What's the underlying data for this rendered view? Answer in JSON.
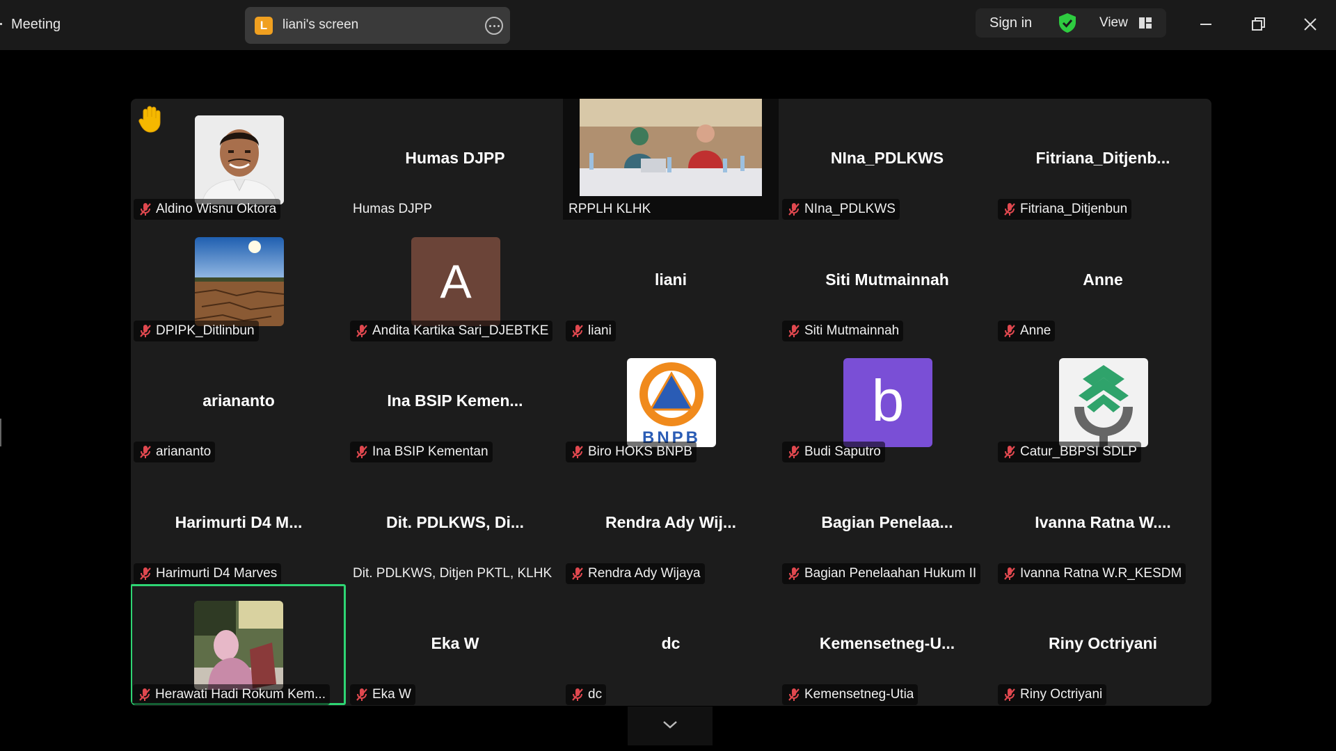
{
  "window": {
    "title": "Meeting",
    "share_badge": "L",
    "share_label": "liani's screen",
    "sign_in": "Sign in",
    "view": "View"
  },
  "colors": {
    "active_speaker": "#2ed573",
    "muted_mic": "#e0484f",
    "raise_hand": "#f5b800",
    "shield": "#2ecc40"
  },
  "gallery": {
    "rows": [
      [
        {
          "name": "Aldino Wisnu Oktora",
          "display": "",
          "kind": "photo-man",
          "muted": true
        },
        {
          "name": "Humas DJPP",
          "display": "Humas DJPP",
          "kind": "name",
          "muted": false
        },
        {
          "name": "RPPLH KLHK",
          "display": "",
          "kind": "video",
          "muted": false
        },
        {
          "name": "NIna_PDLKWS",
          "display": "NIna_PDLKWS",
          "kind": "name",
          "muted": true
        },
        {
          "name": "Fitriana_Ditjenbun",
          "display": "Fitriana_Ditjenb...",
          "kind": "name",
          "muted": true
        }
      ],
      [
        {
          "name": "DPIPK_Ditlinbun",
          "display": "",
          "kind": "photo-land",
          "muted": true
        },
        {
          "name": "Andita Kartika Sari_DJEBTKE",
          "display": "",
          "kind": "letter-a",
          "muted": true
        },
        {
          "name": "liani",
          "display": "liani",
          "kind": "name",
          "muted": true
        },
        {
          "name": "Siti Mutmainnah",
          "display": "Siti Mutmainnah",
          "kind": "name",
          "muted": true
        },
        {
          "name": "Anne",
          "display": "Anne",
          "kind": "name",
          "muted": true
        }
      ],
      [
        {
          "name": "ariananto",
          "display": "ariananto",
          "kind": "name",
          "muted": true
        },
        {
          "name": "Ina BSIP Kementan",
          "display": "Ina BSIP Kemen...",
          "kind": "name",
          "muted": true
        },
        {
          "name": "Biro HOKS BNPB",
          "display": "",
          "kind": "logo-bnpb",
          "muted": true
        },
        {
          "name": "Budi Saputro",
          "display": "",
          "kind": "letter-b",
          "muted": true
        },
        {
          "name": "Catur_BBPSI SDLP",
          "display": "",
          "kind": "logo-green",
          "muted": true
        }
      ],
      [
        {
          "name": "Harimurti D4 Marves",
          "display": "Harimurti D4 M...",
          "kind": "name",
          "muted": true
        },
        {
          "name": "Dit. PDLKWS, Ditjen PKTL, KLHK",
          "display": "Dit. PDLKWS, Di...",
          "kind": "name",
          "muted": false
        },
        {
          "name": "Rendra Ady Wijaya",
          "display": "Rendra Ady Wij...",
          "kind": "name",
          "muted": true
        },
        {
          "name": "Bagian Penelaahan Hukum II",
          "display": "Bagian Penelaa...",
          "kind": "name",
          "muted": true
        },
        {
          "name": "Ivanna Ratna W.R_KESDM",
          "display": "Ivanna Ratna W....",
          "kind": "name",
          "muted": true
        }
      ],
      [
        {
          "name": "Herawati Hadi Rokum Kem...",
          "display": "",
          "kind": "photo-woman",
          "muted": true,
          "active": true
        },
        {
          "name": "Eka W",
          "display": "Eka W",
          "kind": "name",
          "muted": true
        },
        {
          "name": "dc",
          "display": "dc",
          "kind": "name",
          "muted": true
        },
        {
          "name": "Kemensetneg-Utia",
          "display": "Kemensetneg-U...",
          "kind": "name",
          "muted": true
        },
        {
          "name": "Riny Octriyani",
          "display": "Riny Octriyani",
          "kind": "name",
          "muted": true
        }
      ]
    ],
    "avatar_letters": {
      "a": "A",
      "b": "b"
    },
    "logo_text": {
      "bnpb": "BNPB"
    }
  }
}
